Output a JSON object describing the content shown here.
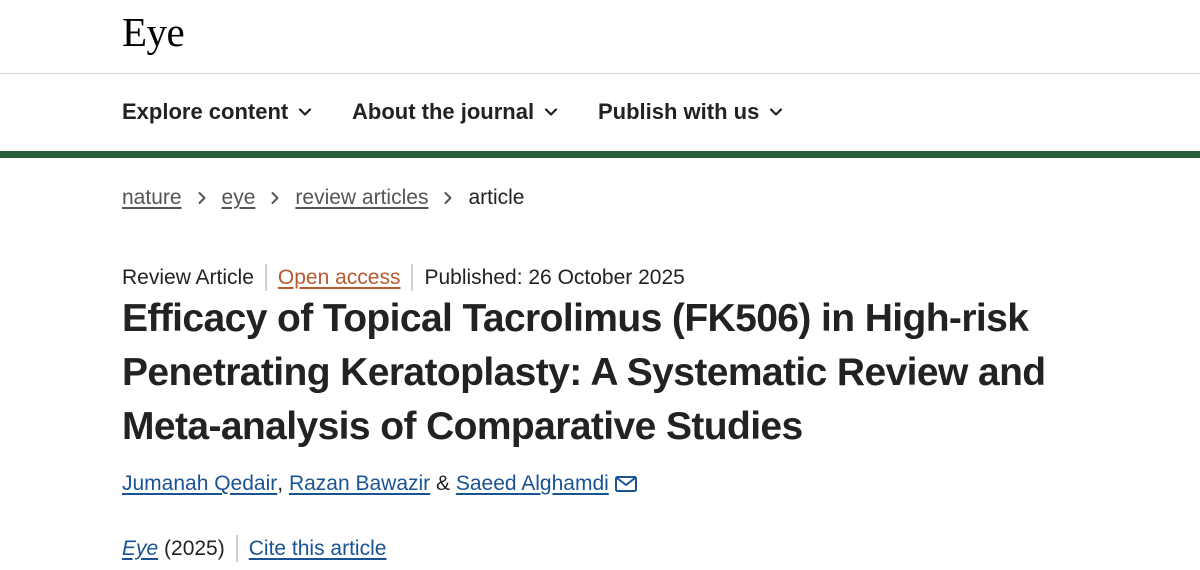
{
  "colors": {
    "accent_bar": "#29603c",
    "link": "#1a5394",
    "open_access": "#b65a30",
    "text": "#222222",
    "muted_link": "#555555"
  },
  "header": {
    "logo": "Eye"
  },
  "nav": {
    "items": [
      {
        "label": "Explore content",
        "icon": "chevron-down-icon"
      },
      {
        "label": "About the journal",
        "icon": "chevron-down-icon"
      },
      {
        "label": "Publish with us",
        "icon": "chevron-down-icon"
      }
    ]
  },
  "breadcrumb": {
    "items": [
      "nature",
      "eye",
      "review articles"
    ],
    "current": "article",
    "separator_icon": "chevron-right-icon"
  },
  "article": {
    "type": "Review Article",
    "access": "Open access",
    "published": "Published: 26 October 2025",
    "title": "Efficacy of Topical Tacrolimus (FK506) in High-risk Penetrating Keratoplasty: A Systematic Review and Meta-analysis of Comparative Studies",
    "authors": [
      "Jumanah Qedair",
      "Razan Bawazir",
      "Saeed Alghamdi"
    ],
    "author_separators": [
      ", ",
      " & "
    ],
    "contact_icon": "envelope-icon",
    "journal": "Eye",
    "year": " (2025)",
    "cite_label": "Cite this article"
  }
}
